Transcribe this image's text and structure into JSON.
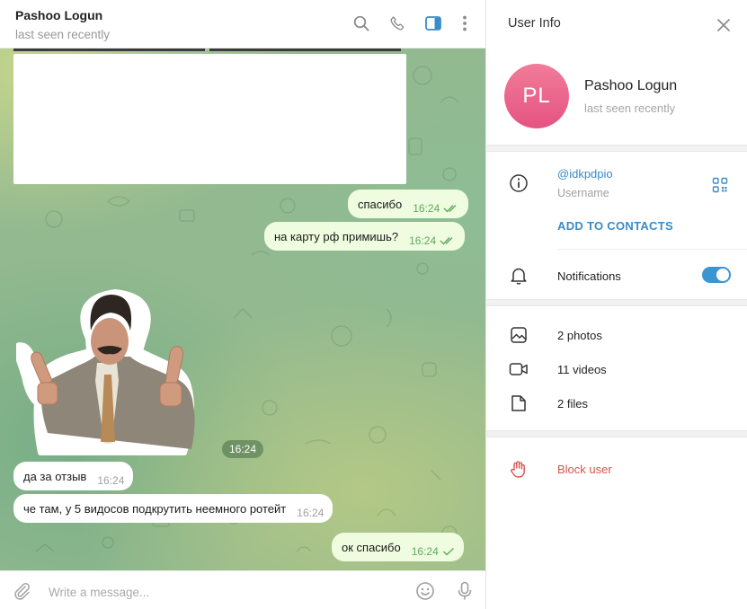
{
  "chat": {
    "title": "Pashoo Logun",
    "status": "last seen recently",
    "header_icons": [
      "search-icon",
      "phone-icon",
      "sidebar-toggle-icon",
      "more-icon"
    ],
    "sticker_time": "16:24",
    "messages": [
      {
        "direction": "out",
        "text": "спасибо",
        "time": "16:24",
        "read": true
      },
      {
        "direction": "out",
        "text": "на карту рф примишь?",
        "time": "16:24",
        "read": true
      },
      {
        "direction": "in",
        "text": "да за отзыв",
        "time": "16:24"
      },
      {
        "direction": "in",
        "text": "че там, у 5 видосов подкрутить неемного ротейт",
        "time": "16:24"
      },
      {
        "direction": "out",
        "text": "ок спасибо",
        "time": "16:24",
        "read": false
      }
    ],
    "composer_placeholder": "Write a message..."
  },
  "info": {
    "title": "User Info",
    "avatar_initials": "PL",
    "name": "Pashoo Logun",
    "status": "last seen recently",
    "username": "@idkpdpio",
    "username_label": "Username",
    "add_contacts": "ADD TO CONTACTS",
    "notifications_label": "Notifications",
    "notifications_on": true,
    "media": {
      "photos": "2 photos",
      "videos": "11 videos",
      "files": "2 files"
    },
    "block": "Block user"
  },
  "colors": {
    "accent": "#3a8bc8",
    "outgoing_bubble": "#effcdf",
    "incoming_bubble": "#ffffff",
    "check": "#5fa95f",
    "danger": "#d9534f",
    "avatar": "#e96489"
  }
}
